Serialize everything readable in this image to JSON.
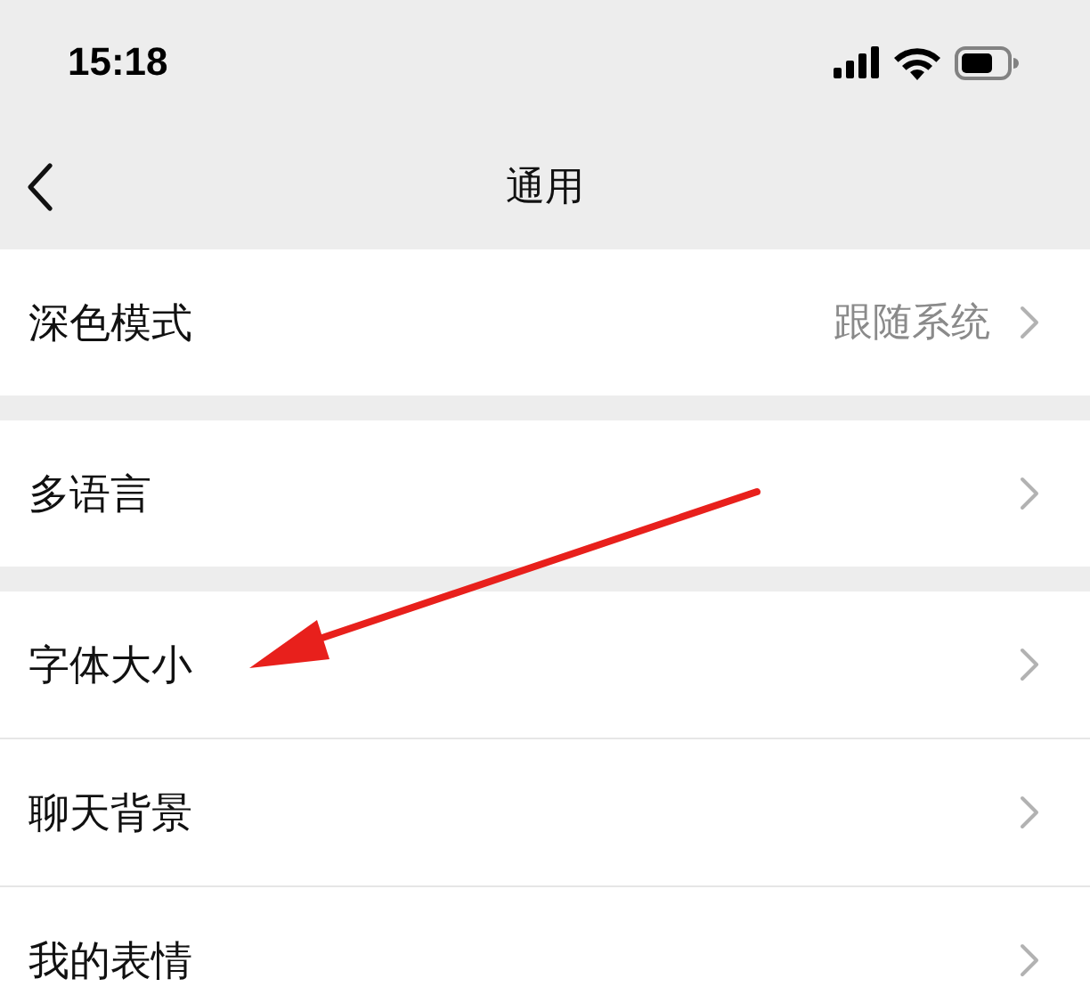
{
  "status_bar": {
    "time": "15:18"
  },
  "nav_bar": {
    "title": "通用"
  },
  "sections": [
    {
      "rows": [
        {
          "label": "深色模式",
          "value": "跟随系统"
        }
      ]
    },
    {
      "rows": [
        {
          "label": "多语言"
        }
      ]
    },
    {
      "rows": [
        {
          "label": "字体大小"
        },
        {
          "label": "聊天背景"
        },
        {
          "label": "我的表情"
        }
      ]
    }
  ]
}
